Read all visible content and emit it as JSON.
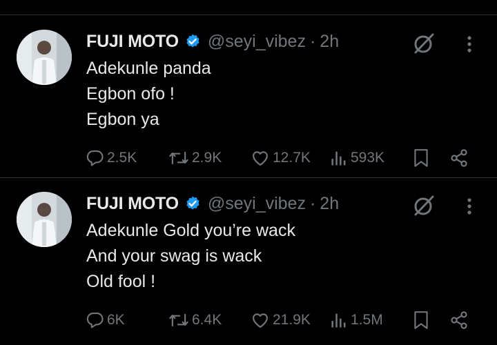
{
  "tweets": [
    {
      "author_name": "FUJI MOTO",
      "handle": "@seyi_vibez",
      "separator": "·",
      "time": "2h",
      "lines": [
        "Adekunle panda",
        "Egbon ofo !",
        "Egbon ya"
      ],
      "stats": {
        "replies": "2.5K",
        "reposts": "2.9K",
        "likes": "12.7K",
        "views": "593K"
      }
    },
    {
      "author_name": "FUJI MOTO",
      "handle": "@seyi_vibez",
      "separator": "·",
      "time": "2h",
      "lines": [
        "Adekunle Gold you’re wack",
        "And your swag is wack",
        "Old fool !"
      ],
      "stats": {
        "replies": "6K",
        "reposts": "6.4K",
        "likes": "21.9K",
        "views": "1.5M"
      }
    }
  ],
  "colors": {
    "background": "#000000",
    "text": "#e7e9ea",
    "muted": "#71767b",
    "verified": "#1d9bf0",
    "divider": "#2f3336"
  },
  "icons": [
    "verified-badge-icon",
    "grok-icon",
    "more-icon",
    "reply-icon",
    "repost-icon",
    "like-icon",
    "views-icon",
    "bookmark-icon",
    "share-icon"
  ]
}
